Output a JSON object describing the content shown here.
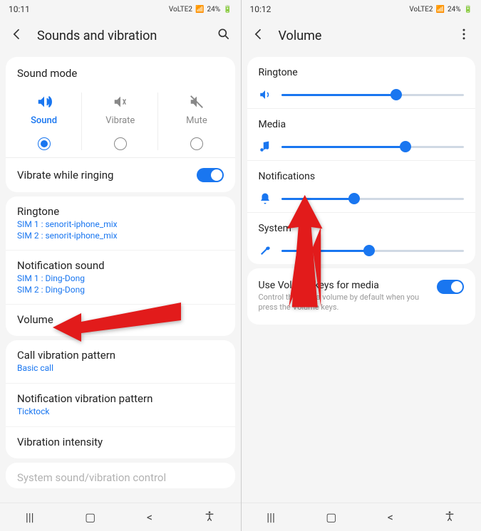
{
  "left": {
    "statusbar": {
      "time": "10:11",
      "battery": "24%",
      "net": "VoLTE2"
    },
    "header": {
      "title": "Sounds and vibration"
    },
    "soundmode_title": "Sound mode",
    "modes": [
      {
        "label": "Sound",
        "active": true
      },
      {
        "label": "Vibrate",
        "active": false
      },
      {
        "label": "Mute",
        "active": false
      }
    ],
    "vibrate_ringing": "Vibrate while ringing",
    "items": [
      {
        "title": "Ringtone",
        "sub1": "SIM 1 : senorit-iphone_mix",
        "sub2": "SIM 2 : senorit-iphone_mix"
      },
      {
        "title": "Notification sound",
        "sub1": "SIM 1 : Ding-Dong",
        "sub2": "SIM 2 : Ding-Dong"
      },
      {
        "title": "Volume"
      }
    ],
    "items2": [
      {
        "title": "Call vibration pattern",
        "sub1": "Basic call"
      },
      {
        "title": "Notification vibration pattern",
        "sub1": "Ticktock"
      },
      {
        "title": "Vibration intensity"
      }
    ],
    "cutoff": "System sound/vibration control"
  },
  "right": {
    "statusbar": {
      "time": "10:12",
      "battery": "24%",
      "net": "VoLTE2"
    },
    "header": {
      "title": "Volume"
    },
    "volumes": [
      {
        "label": "Ringtone",
        "pct": 63
      },
      {
        "label": "Media",
        "pct": 68
      },
      {
        "label": "Notifications",
        "pct": 40
      },
      {
        "label": "System",
        "pct": 48
      }
    ],
    "vk": {
      "title": "Use Volume keys for media",
      "sub": "Control the media volume by default when you press the Volume keys."
    }
  }
}
